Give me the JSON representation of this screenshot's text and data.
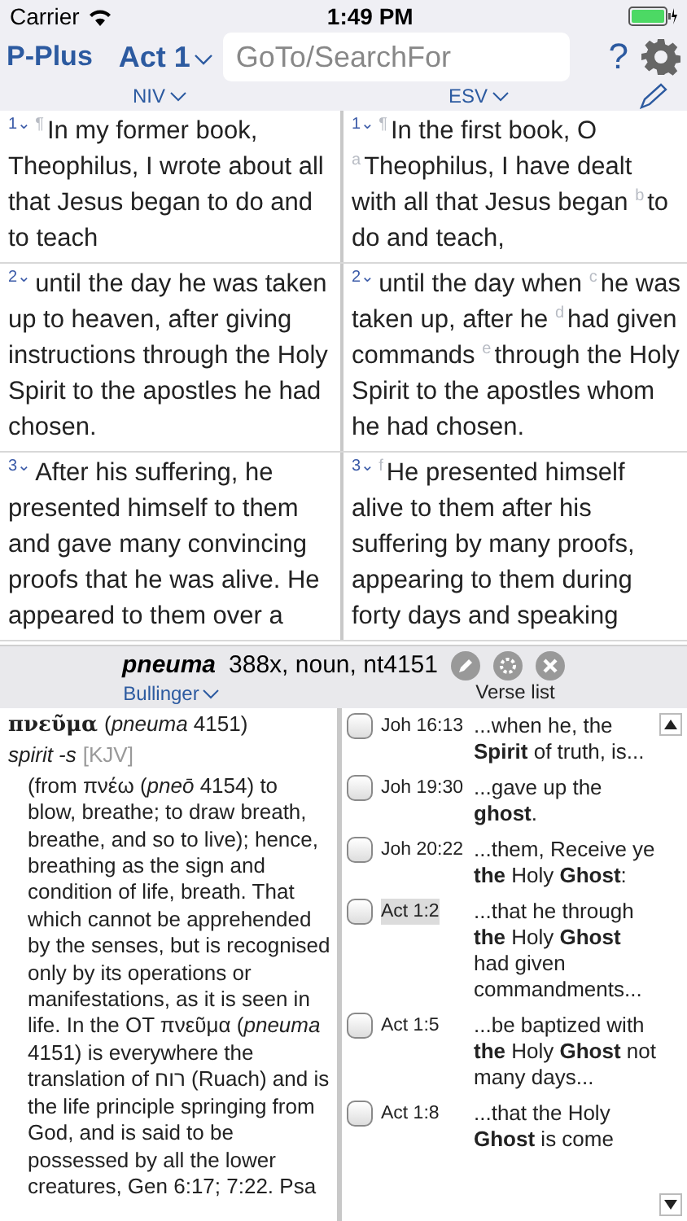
{
  "status_bar": {
    "carrier": "Carrier",
    "time": "1:49 PM"
  },
  "toolbar": {
    "app_name": "P-Plus",
    "book": "Act 1",
    "search": {
      "placeholder": "GoTo/SearchFor"
    },
    "help": "?"
  },
  "versions": [
    "NIV",
    "ESV"
  ],
  "verses": [
    {
      "left_number": "1⌄",
      "right_number": "1⌄",
      "left": "$^{¶}$In my former book, Theophilus, I wrote about all that Jesus began to do and to teach",
      "right": "$^{¶}$In the first book, O $^{a}$Theophilus, I have dealt with all that Jesus began $^{b}$to do and teach,"
    },
    {
      "left_number": "2⌄",
      "right_number": "2⌄",
      "left": "until the day he was taken up to heaven, after giving instructions through the Holy Spirit to the apostles he had chosen.",
      "right": "until the day when $^{c}$he was taken up, after he $^{d}$had given commands $^{e}$through the Holy Spirit to the apostles whom he had chosen."
    },
    {
      "left_number": "3⌄",
      "right_number": "3⌄",
      "left": "After his suffering, he presented himself to them and gave many convincing proofs that he was alive. He appeared to them over a",
      "right": "$^{f}$He presented himself alive to them after his suffering by many proofs, appearing to them during forty days and speaking"
    }
  ],
  "word_bar": {
    "word": "pneuma",
    "info": "388x, noun, nt4151"
  },
  "lexicon": {
    "name": "Bullinger",
    "headword": "πνεῦμα",
    "headword_note": "(*pneuma* 4151)",
    "gloss": "spirit -s",
    "source": "[KJV]",
    "body": "(from πνέω (*pneō* 4154) to blow, breathe; to draw breath, breathe, and so to live); hence, breathing as the sign and condition of life, breath. That which cannot be apprehended by the senses, but is recognised only by its operations or manifestations, as it is seen in life. In the OT πνεῦμα (*pneuma* 4151) is everywhere the translation of רוח (Ruach) and is the life principle springing from God, and is said to be possessed by all the lower creatures, Gen 6:17; 7:22. Psa"
  },
  "verse_list": {
    "title": "Verse list",
    "items": [
      {
        "ref": "Joh 16:13",
        "snippet": "...when he, the **Spirit** of truth, is...",
        "checked": false,
        "selected": false
      },
      {
        "ref": "Joh 19:30",
        "snippet": "...gave up the **ghost**.",
        "checked": false,
        "selected": false
      },
      {
        "ref": "Joh 20:22",
        "snippet": "...them, Receive ye **the** Holy **Ghost**:",
        "checked": false,
        "selected": false
      },
      {
        "ref": "Act 1:2",
        "snippet": "...that he through **the** Holy **Ghost** had given commandments...",
        "checked": false,
        "selected": true
      },
      {
        "ref": "Act 1:5",
        "snippet": "...be baptized with **the** Holy **Ghost** not many days...",
        "checked": false,
        "selected": false
      },
      {
        "ref": "Act 1:8",
        "snippet": "...that the Holy **Ghost** is come",
        "checked": false,
        "selected": false
      }
    ]
  }
}
